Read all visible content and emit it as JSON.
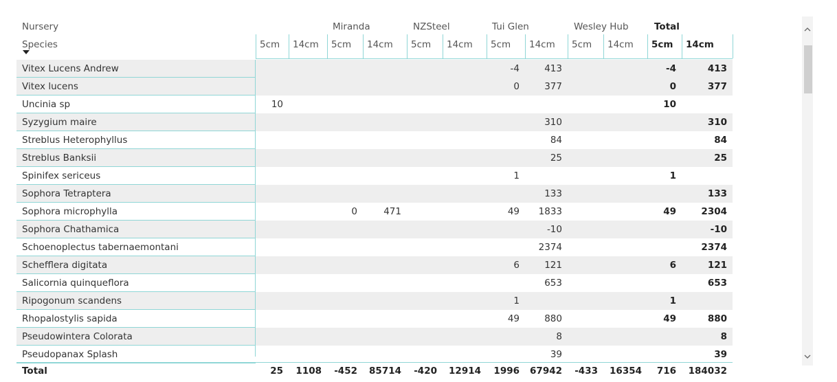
{
  "matrix": {
    "row_header_top": "Nursery",
    "row_header_bottom": "Species",
    "groups": [
      "Miranda",
      "NZSteel",
      "Tui Glen",
      "Wesley Hub",
      "Total"
    ],
    "subcolumns": [
      "5cm",
      "14cm",
      "5cm",
      "14cm",
      "5cm",
      "14cm",
      "5cm",
      "14cm",
      "5cm",
      "14cm",
      "5cm",
      "14cm"
    ],
    "rows": [
      {
        "label": "Vitex Lucens Andrew",
        "values": [
          "",
          "",
          "",
          "",
          "",
          "",
          "-4",
          "413",
          "",
          "",
          "-4",
          "413"
        ]
      },
      {
        "label": "Vitex lucens",
        "values": [
          "",
          "",
          "",
          "",
          "",
          "",
          "0",
          "377",
          "",
          "",
          "0",
          "377"
        ]
      },
      {
        "label": "Uncinia sp",
        "values": [
          "10",
          "",
          "",
          "",
          "",
          "",
          "",
          "",
          "",
          "",
          "10",
          ""
        ]
      },
      {
        "label": "Syzygium maire",
        "values": [
          "",
          "",
          "",
          "",
          "",
          "",
          "",
          "310",
          "",
          "",
          "",
          "310"
        ]
      },
      {
        "label": "Streblus Heterophyllus",
        "values": [
          "",
          "",
          "",
          "",
          "",
          "",
          "",
          "84",
          "",
          "",
          "",
          "84"
        ]
      },
      {
        "label": "Streblus Banksii",
        "values": [
          "",
          "",
          "",
          "",
          "",
          "",
          "",
          "25",
          "",
          "",
          "",
          "25"
        ]
      },
      {
        "label": "Spinifex sericeus",
        "values": [
          "",
          "",
          "",
          "",
          "",
          "",
          "1",
          "",
          "",
          "",
          "1",
          ""
        ]
      },
      {
        "label": "Sophora Tetraptera",
        "values": [
          "",
          "",
          "",
          "",
          "",
          "",
          "",
          "133",
          "",
          "",
          "",
          "133"
        ]
      },
      {
        "label": "Sophora microphylla",
        "values": [
          "",
          "",
          "0",
          "471",
          "",
          "",
          "49",
          "1833",
          "",
          "",
          "49",
          "2304"
        ]
      },
      {
        "label": "Sophora Chathamica",
        "values": [
          "",
          "",
          "",
          "",
          "",
          "",
          "",
          "-10",
          "",
          "",
          "",
          "-10"
        ]
      },
      {
        "label": "Schoenoplectus tabernaemontani",
        "values": [
          "",
          "",
          "",
          "",
          "",
          "",
          "",
          "2374",
          "",
          "",
          "",
          "2374"
        ]
      },
      {
        "label": "Schefflera digitata",
        "values": [
          "",
          "",
          "",
          "",
          "",
          "",
          "6",
          "121",
          "",
          "",
          "6",
          "121"
        ]
      },
      {
        "label": "Salicornia quinqueflora",
        "values": [
          "",
          "",
          "",
          "",
          "",
          "",
          "",
          "653",
          "",
          "",
          "",
          "653"
        ]
      },
      {
        "label": "Ripogonum scandens",
        "values": [
          "",
          "",
          "",
          "",
          "",
          "",
          "1",
          "",
          "",
          "",
          "1",
          ""
        ]
      },
      {
        "label": "Rhopalostylis sapida",
        "values": [
          "",
          "",
          "",
          "",
          "",
          "",
          "49",
          "880",
          "",
          "",
          "49",
          "880"
        ]
      },
      {
        "label": "Pseudowintera Colorata",
        "values": [
          "",
          "",
          "",
          "",
          "",
          "",
          "",
          "8",
          "",
          "",
          "",
          "8"
        ]
      },
      {
        "label": "Pseudopanax Splash",
        "values": [
          "",
          "",
          "",
          "",
          "",
          "",
          "",
          "39",
          "",
          "",
          "",
          "39"
        ]
      }
    ],
    "total": {
      "label": "Total",
      "values": [
        "25",
        "1108",
        "-452",
        "85714",
        "-420",
        "12914",
        "1996",
        "67942",
        "-433",
        "16354",
        "716",
        "184032"
      ]
    }
  }
}
